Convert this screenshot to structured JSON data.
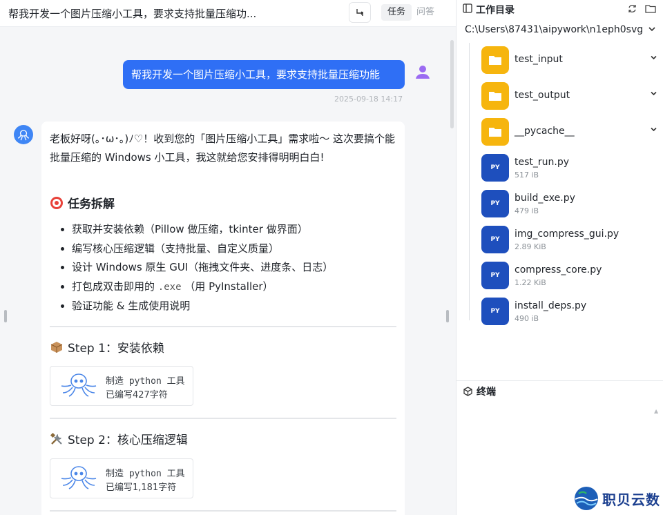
{
  "header": {
    "title": "帮我开发一个图片压缩小工具，要求支持批量压缩功...",
    "tabs": [
      "任务",
      "问答"
    ]
  },
  "user_message": {
    "text": "帮我开发一个图片压缩小工具，要求支持批量压缩功能",
    "time": "2025-09-18 14:17"
  },
  "assistant": {
    "intro": "老板好呀(｡･ω･｡)ﾉ♡！收到您的「图片压缩小工具」需求啦～ 这次要搞个能批量压缩的 Windows 小工具，我这就给您安排得明明白白!",
    "task_title": "任务拆解",
    "tasks": [
      "获取并安装依赖（Pillow 做压缩，tkinter 做界面）",
      "编写核心压缩逻辑（支持批量、自定义质量）",
      "设计 Windows 原生 GUI（拖拽文件夹、进度条、日志）",
      "打包成双击即用的",
      "验证功能 & 生成使用说明"
    ],
    "task4_code": ".exe",
    "task4_tail": "（用 PyInstaller）",
    "steps": [
      {
        "title": "Step 1：安装依赖",
        "tool": "制造 python 工具",
        "status": "已编写427字符"
      },
      {
        "title": "Step 2：核心压缩逻辑",
        "tool": "制造 python 工具",
        "status": "已编写1,181字符"
      }
    ]
  },
  "workdir": {
    "title": "工作目录",
    "path": "C:\\Users\\87431\\aipywork\\n1eph0svg",
    "items": [
      {
        "name": "test_input",
        "type": "folder"
      },
      {
        "name": "test_output",
        "type": "folder"
      },
      {
        "name": "__pycache__",
        "type": "folder"
      },
      {
        "name": "test_run.py",
        "type": "py",
        "size": "517 iB"
      },
      {
        "name": "build_exe.py",
        "type": "py",
        "size": "479 iB"
      },
      {
        "name": "img_compress_gui.py",
        "type": "py",
        "size": "2.89 KiB"
      },
      {
        "name": "compress_core.py",
        "type": "py",
        "size": "1.22 KiB"
      },
      {
        "name": "install_deps.py",
        "type": "py",
        "size": "490 iB"
      }
    ],
    "py_badge": "PY"
  },
  "terminal": {
    "title": "终端"
  },
  "brand": {
    "name": "职贝云数"
  },
  "colors": {
    "accent": "#2f6ff5",
    "folder": "#f6b50e",
    "pyfile": "#1e4fbd"
  }
}
